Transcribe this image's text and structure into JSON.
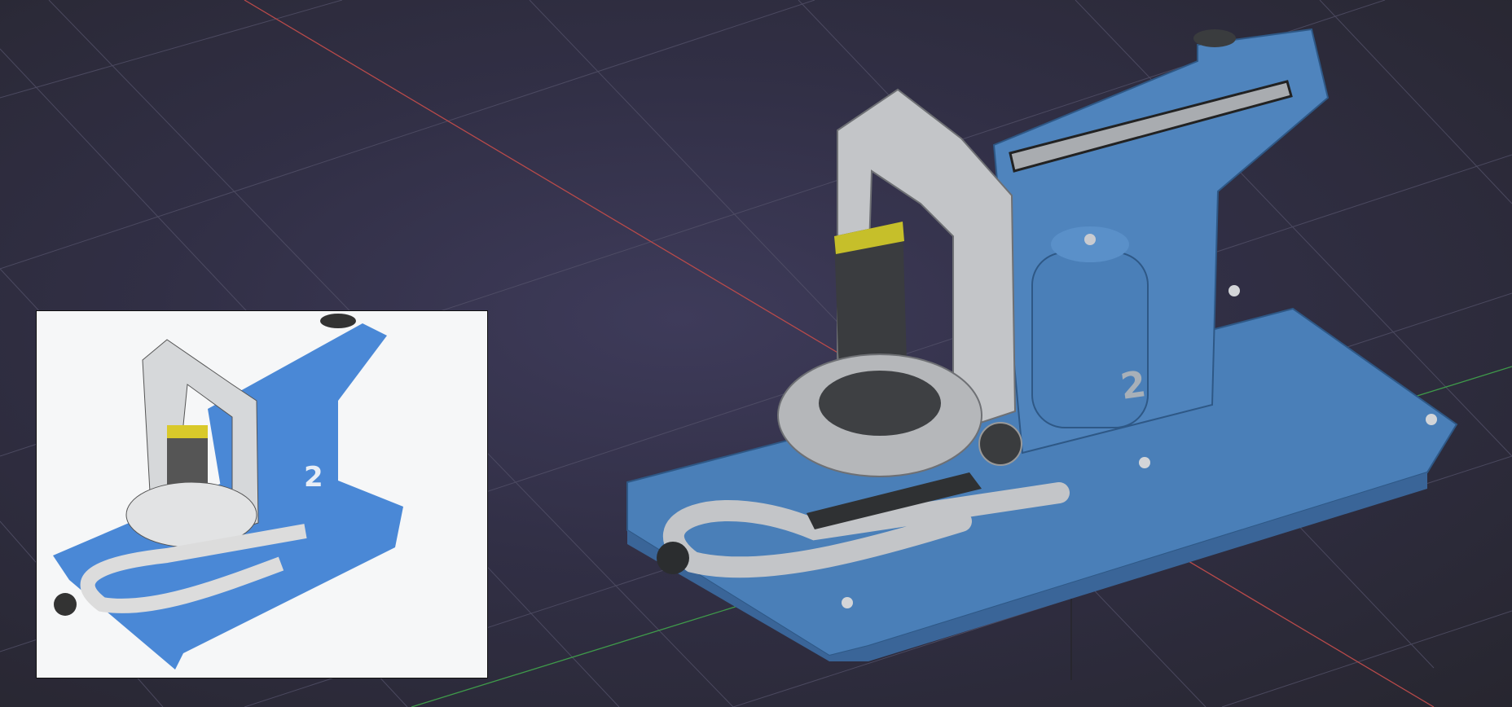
{
  "viewport": {
    "model_label": "2",
    "reference_label": "2",
    "colors": {
      "x_axis": "#b84a4a",
      "y_axis": "#3f9a4a",
      "grid": "#4a4860",
      "body_blue": "#4a7fb8",
      "metal_grey": "#bfc1c4",
      "dark_part": "#3c3e40",
      "accent_yellow": "#c6bf2a"
    }
  }
}
